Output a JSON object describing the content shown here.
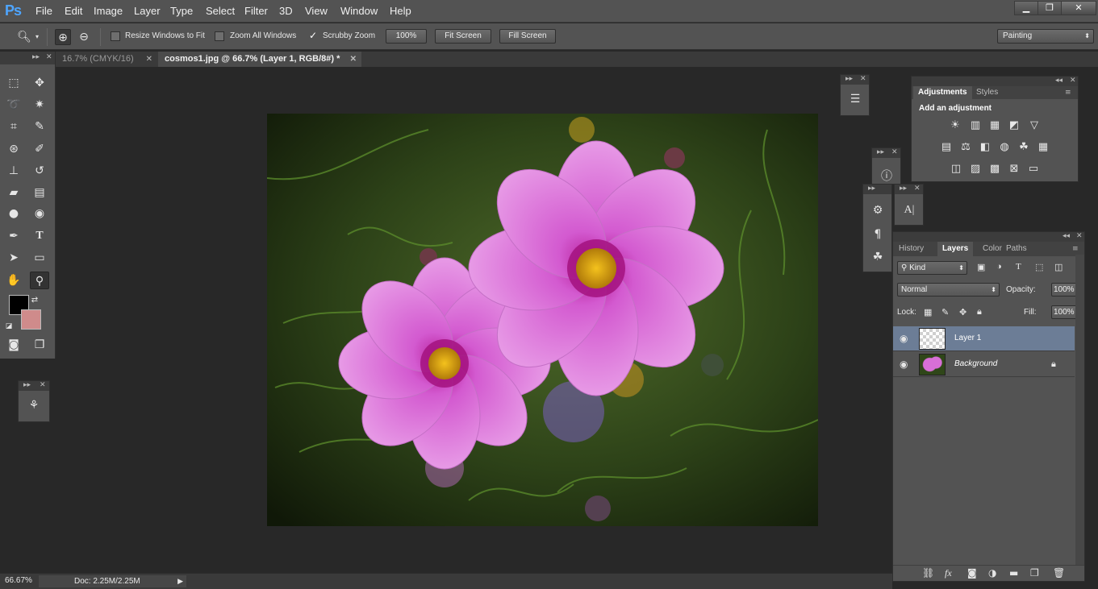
{
  "app": {
    "logo": "Ps"
  },
  "menu": [
    "File",
    "Edit",
    "Image",
    "Layer",
    "Type",
    "Select",
    "Filter",
    "3D",
    "View",
    "Window",
    "Help"
  ],
  "window_controls": {
    "minimize": "▁",
    "restore": "❐",
    "close": "✕"
  },
  "options_bar": {
    "zoom_tool_icon": "magnifier-icon",
    "resize_windows_label": "Resize Windows to Fit",
    "resize_windows_checked": false,
    "zoom_all_label": "Zoom All Windows",
    "zoom_all_checked": false,
    "scrubby_zoom_label": "Scrubby Zoom",
    "scrubby_zoom_checked": true,
    "zoom_100_label": "100%",
    "fit_screen_label": "Fit Screen",
    "fill_screen_label": "Fill Screen",
    "workspace": "Painting"
  },
  "tabs": [
    {
      "label": "16.7% (CMYK/16)",
      "active": false
    },
    {
      "label": "cosmos1.jpg @ 66.7% (Layer 1, RGB/8#) *",
      "active": true
    }
  ],
  "colors": {
    "foreground": "#000000",
    "background": "#cf8b8b",
    "selection": "#6c7d96",
    "ui_bg": "#535353"
  },
  "adjustments": {
    "tabs": [
      "Adjustments",
      "Styles"
    ],
    "heading": "Add an adjustment"
  },
  "layers_panel": {
    "tabs": [
      "History",
      "Layers",
      "Color",
      "Paths"
    ],
    "filter_kind": "Kind",
    "blend_mode": "Normal",
    "opacity_label": "Opacity:",
    "opacity_value": "100%",
    "lock_label": "Lock:",
    "fill_label": "Fill:",
    "fill_value": "100%",
    "layers": [
      {
        "name": "Layer 1",
        "selected": true,
        "locked": false
      },
      {
        "name": "Background",
        "selected": false,
        "locked": true
      }
    ]
  },
  "status": {
    "zoom": "66.67%",
    "doc": "Doc: 2.25M/2.25M"
  }
}
